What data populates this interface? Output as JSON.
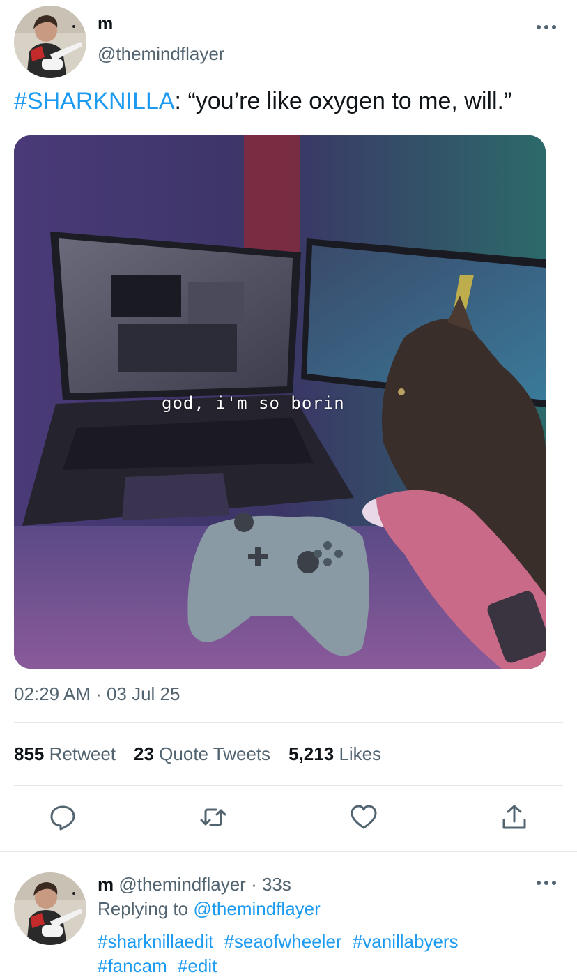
{
  "tweet": {
    "author_name": "m",
    "author_handle": "@themindflayer",
    "hashtag": "#SHARKNILLA",
    "text": ": “you’re like oxygen to me, will.”",
    "media_caption": "god, i'm so borin",
    "timestamp": "02:29 AM · 03 Jul 25",
    "stats": [
      {
        "count": "855",
        "label": "Retweet"
      },
      {
        "count": "23",
        "label": "Quote Tweets"
      },
      {
        "count": "5,213",
        "label": "Likes"
      }
    ],
    "actions": [
      "reply-icon",
      "retweet-icon",
      "like-icon",
      "share-icon"
    ]
  },
  "reply": {
    "author_name": "m",
    "author_handle": "@themindflayer",
    "time": "· 33s",
    "replying_label": "Replying to",
    "replying_to": "@themindflayer",
    "hashtags": [
      "#sharknillaedit",
      "#seaofwheeler",
      "#vanillabyers",
      "#fancam",
      "#edit"
    ]
  },
  "colors": {
    "link": "#1d9bf0",
    "muted": "#536471",
    "text": "#0f1419",
    "divider": "#e4e8eb"
  }
}
